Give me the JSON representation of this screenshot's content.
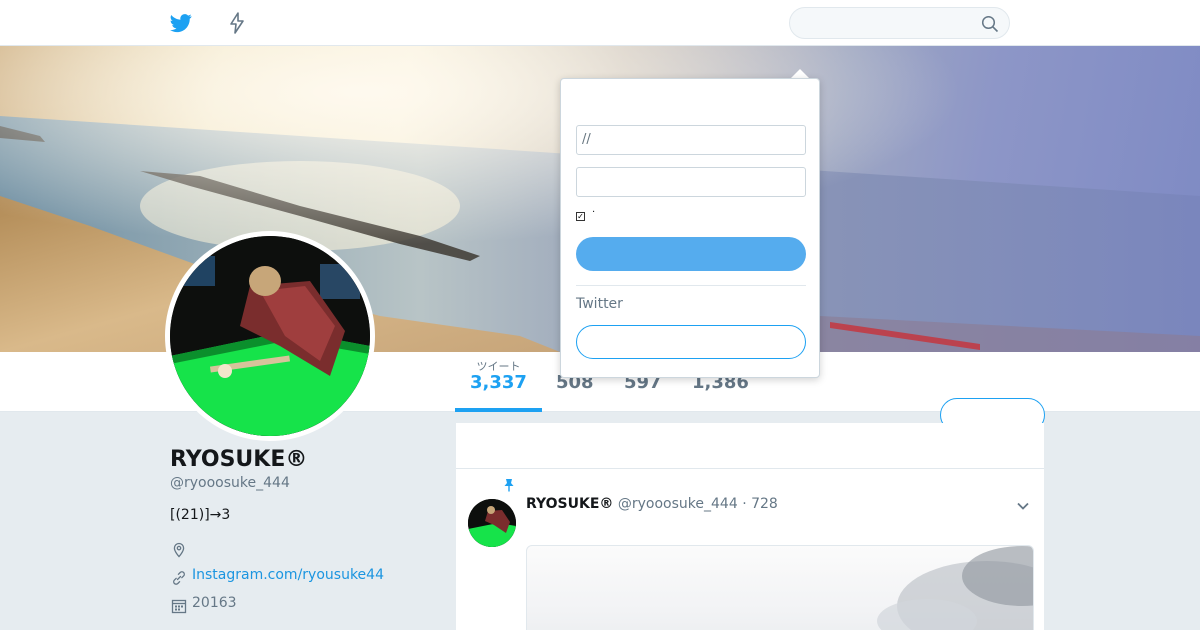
{
  "colors": {
    "accent": "#1da1f2",
    "login_button": "#55acee",
    "link": "#1b95e0",
    "page_background": "#e6ecf0"
  },
  "nav": {
    "icons": [
      "twitter-bird-icon",
      "moments-lightning-icon",
      "search-icon"
    ],
    "search": {
      "placeholder": ""
    }
  },
  "login_popup": {
    "username_field_value": "//",
    "password_field_value": "",
    "remember_checked": true,
    "remember_label": "·",
    "signup_prompt": "Twitter"
  },
  "profile": {
    "name": "RYOSUKE®",
    "handle": "@ryooosuke_444",
    "bio": "[(21)]→3",
    "location": "",
    "website": "Instagram.com/ryousuke44",
    "joined": "20163"
  },
  "stats": [
    {
      "label": "ツイート",
      "value": "3,337",
      "active": true
    },
    {
      "label": "",
      "value": "508",
      "active": false
    },
    {
      "label": "",
      "value": "597",
      "active": false
    },
    {
      "label": "",
      "value": "1,386",
      "active": false
    }
  ],
  "tweet": {
    "pinned": true,
    "author_name": "RYOSUKE®",
    "author_handle": "@ryooosuke_444",
    "separator": "·",
    "time": "728"
  }
}
